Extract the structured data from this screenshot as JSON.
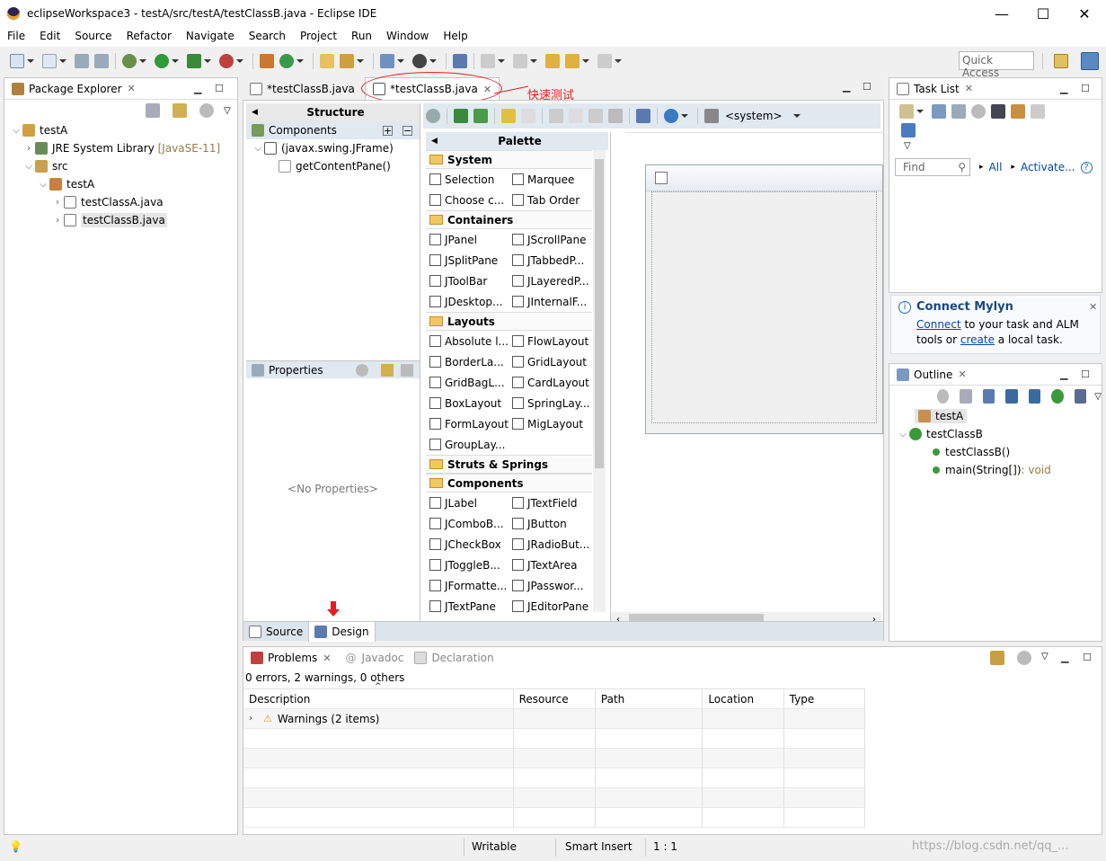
{
  "window": {
    "title": "eclipseWorkspace3 - testA/src/testA/testClassB.java - Eclipse IDE",
    "minimize": "—",
    "maximize": "☐",
    "close": "✕"
  },
  "menu": [
    "File",
    "Edit",
    "Source",
    "Refactor",
    "Navigate",
    "Search",
    "Project",
    "Run",
    "Window",
    "Help"
  ],
  "toolbar": {
    "quick_access": "Quick Access"
  },
  "package_explorer": {
    "title": "Package Explorer",
    "items": [
      {
        "label": "testA"
      },
      {
        "label": "JRE System Library",
        "suffix": "[JavaSE-11]"
      },
      {
        "label": "src"
      },
      {
        "label": "testA"
      },
      {
        "label": "testClassA.java"
      },
      {
        "label": "testClassB.java"
      }
    ]
  },
  "editor": {
    "tabs": [
      "*testClassB.java",
      "*testClassB.java"
    ],
    "annotation": "快速测试",
    "structure": {
      "title": "Structure",
      "components_title": "Components",
      "tree": [
        "(javax.swing.JFrame)",
        "getContentPane()"
      ]
    },
    "properties": {
      "title": "Properties",
      "empty": "<No Properties>"
    },
    "toolbar_system": "<system>",
    "palette": {
      "title": "Palette",
      "categories": [
        {
          "name": "System",
          "items": [
            "Selection",
            "Marquee",
            "Choose c...",
            "Tab Order"
          ]
        },
        {
          "name": "Containers",
          "items": [
            "JPanel",
            "JScrollPane",
            "JSplitPane",
            "JTabbedP...",
            "JToolBar",
            "JLayeredP...",
            "JDesktop...",
            "JInternalF..."
          ]
        },
        {
          "name": "Layouts",
          "items": [
            "Absolute l...",
            "FlowLayout",
            "BorderLa...",
            "GridLayout",
            "GridBagL...",
            "CardLayout",
            "BoxLayout",
            "SpringLay...",
            "FormLayout",
            "MigLayout",
            "GroupLay..."
          ]
        },
        {
          "name": "Struts & Springs",
          "items": []
        },
        {
          "name": "Components",
          "items": [
            "JLabel",
            "JTextField",
            "JComboB...",
            "JButton",
            "JCheckBox",
            "JRadioBut...",
            "JToggleB...",
            "JTextArea",
            "JFormatte...",
            "JPasswor...",
            "JTextPane",
            "JEditorPane"
          ]
        }
      ]
    },
    "bottom_tabs": [
      "Source",
      "Design"
    ]
  },
  "task_list": {
    "title": "Task List",
    "find_placeholder": "Find",
    "all": "All",
    "activate": "Activate..."
  },
  "mylyn": {
    "title": "Connect Mylyn",
    "connect": "Connect",
    "text1": " to your task and ALM",
    "text2": "tools or ",
    "create": "create",
    "text3": " a local task."
  },
  "outline": {
    "title": "Outline",
    "items": [
      "testA",
      "testClassB",
      "testClassB()",
      "main(String[])",
      " : void"
    ]
  },
  "problems": {
    "tabs": [
      "Problems",
      "Javadoc",
      "Declaration"
    ],
    "summary": "0 errors, 2 warnings, 0 others",
    "columns": [
      "Description",
      "Resource",
      "Path",
      "Location",
      "Type"
    ],
    "rows": [
      {
        "description": "Warnings (2 items)"
      }
    ]
  },
  "status": {
    "writable": "Writable",
    "insert": "Smart Insert",
    "position": "1 : 1",
    "watermark": "https://blog.csdn.net/qq_..."
  }
}
